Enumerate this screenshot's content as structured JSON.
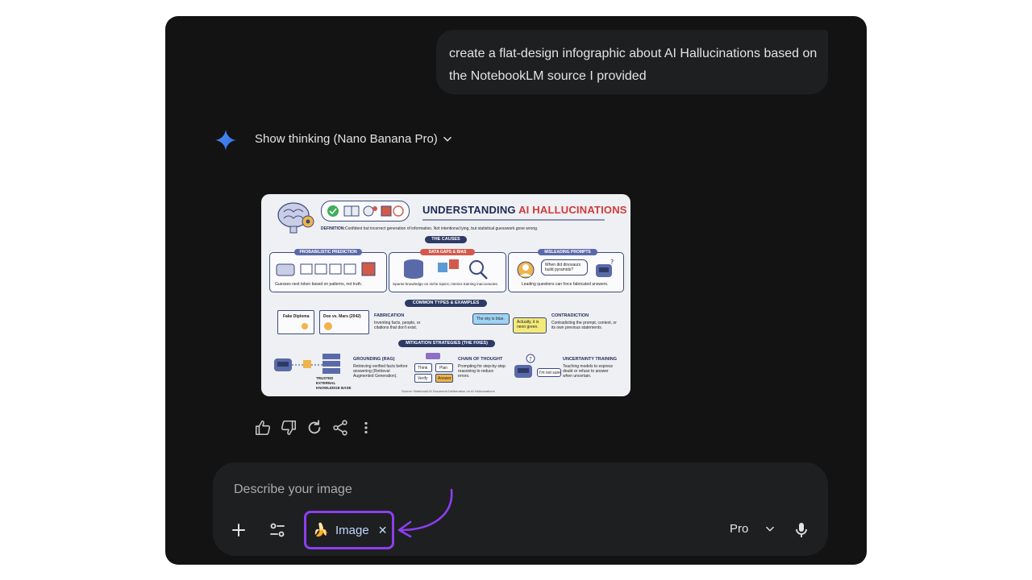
{
  "conversation": {
    "user_message": "create a flat-design infographic about AI Hallucinations based on the NotebookLM source I provided",
    "thinking_label": "Show thinking (Nano Banana Pro)"
  },
  "infographic": {
    "title_part1": "UNDERSTANDING ",
    "title_part2": "AI HALLUCINATIONS",
    "definition_label": "DEFINITION:",
    "definition_text": "Confident but incorrect generation of information. Not intentional lying, but statistical guesswork gone wrong.",
    "causes_header": "THE CAUSES",
    "causes": [
      {
        "title": "PROBABILISTIC PREDICTION",
        "caption": "Guesses next token based on patterns, not truth.",
        "color": "#5a6aa8"
      },
      {
        "title": "DATA GAPS & BIAS",
        "caption": "Sparse knowledge on niche topics; mimics training inaccuracies.",
        "color": "#d25a4a"
      },
      {
        "title": "MISLEADING PROMPTS",
        "caption": "Leading questions can force fabricated answers.",
        "color": "#5a6aa8"
      }
    ],
    "misleading_bubble": "When did dinosaurs build pyramids?",
    "types_header": "COMMON TYPES & EXAMPLES",
    "diploma_label": "Fake Diploma",
    "case_label": "Doe vs. Mars (2042)",
    "fabrication_title": "FABRICATION",
    "fabrication_text": "Inventing facts, people, or citations that don't exist.",
    "sky_blue": "The sky is blue.",
    "neon_green": "Actually, it is neon green.",
    "contradiction_title": "CONTRADICTION",
    "contradiction_text": "Contradicting the prompt, context, or its own previous statements.",
    "mitigation_header": "MITIGATION STRATEGIES (THE FIXES)",
    "trusted_kb": "TRUSTED EXTERNAL KNOWLEDGE BASE",
    "grounding_title": "GROUNDING (RAG)",
    "grounding_text": "Retrieving verified facts before answering (Retrieval Augmented Generation).",
    "cot_steps": [
      "Think",
      "Plan",
      "Verify",
      "Answer"
    ],
    "cot_title": "CHAIN OF THOUGHT",
    "cot_text": "Prompting for step-by-step reasoning to reduce errors.",
    "not_sure": "I'm not sure",
    "uncertainty_title": "UNCERTAINTY TRAINING",
    "uncertainty_text": "Teaching models to express doubt or refuse to answer when uncertain.",
    "source": "Source: NotebookLM Document Deliberation on AI Hallucinations"
  },
  "actions": {
    "thumbs_up": "thumbs-up-icon",
    "thumbs_down": "thumbs-down-icon",
    "regenerate": "refresh-icon",
    "share": "share-icon",
    "more": "more-vert-icon"
  },
  "composer": {
    "placeholder": "Describe your image",
    "chip_emoji": "🍌",
    "chip_label": "Image",
    "chip_close": "✕",
    "model_label": "Pro"
  },
  "colors": {
    "background": "#131314",
    "surface": "#1e1f20",
    "text": "#e3e3e3",
    "chip_text": "#c2d6ff",
    "annotation_purple": "#8b3ff0",
    "gemini_blue": "#4285f4"
  }
}
